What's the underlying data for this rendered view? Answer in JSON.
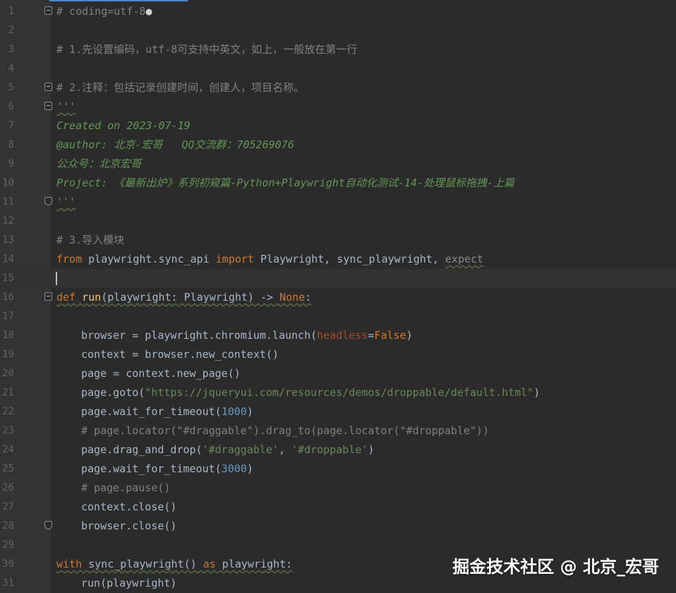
{
  "editor": {
    "lines": [
      "1",
      "2",
      "3",
      "4",
      "5",
      "6",
      "7",
      "8",
      "9",
      "10",
      "11",
      "12",
      "13",
      "14",
      "15",
      "16",
      "17",
      "18",
      "19",
      "20",
      "21",
      "22",
      "23",
      "24",
      "25",
      "26",
      "27",
      "28",
      "29",
      "30",
      "31"
    ],
    "code": {
      "l1": "# coding=utf-8",
      "l3": "# 1.先设置编码，utf-8可支持中英文，如上，一般放在第一行",
      "l5": "# 2.注释：包括记录创建时间，创建人，项目名称。",
      "l6": "'''",
      "l7": "Created on 2023-07-19",
      "l8": "@author: 北京-宏哥   QQ交流群：705269076",
      "l9": "公众号：北京宏哥",
      "l10": "Project: 《最新出炉》系列初窥篇-Python+Playwright自动化测试-14-处理鼠标拖拽-上篇",
      "l11": "'''",
      "l13": "# 3.导入模块",
      "l14": {
        "from": "from",
        "module": " playwright.sync_api ",
        "import": "import",
        "names": " Playwright, sync_playwright, ",
        "expect": "expect"
      },
      "l16": {
        "def": "def",
        "name": "run",
        "sig_a": "(playwright: Playwright) -> ",
        "none": "None",
        "colon": ":"
      },
      "l18": {
        "a": "browser = playwright.chromium.launch(",
        "param": "headless",
        "eq": "=",
        "val": "False",
        "b": ")"
      },
      "l19": "context = browser.new_context()",
      "l20": "page = context.new_page()",
      "l21": {
        "a": "page.goto(",
        "url": "\"https://jqueryui.com/resources/demos/droppable/default.html\"",
        "b": ")"
      },
      "l22": {
        "a": "page.wait_for_timeout(",
        "num": "1000",
        "b": ")"
      },
      "l23": "# page.locator(\"#draggable\").drag_to(page.locator(\"#droppable\"))",
      "l24": {
        "a": "page.drag_and_drop(",
        "s1": "'#draggable'",
        "sep": ", ",
        "s2": "'#droppable'",
        "b": ")"
      },
      "l25": {
        "a": "page.wait_for_timeout(",
        "num": "3000",
        "b": ")"
      },
      "l26": "# page.pause()",
      "l27": "context.close()",
      "l28": "browser.close()",
      "l30": {
        "with": "with",
        "a": " sync_playwright() ",
        "as": "as",
        "b": " playwright:"
      },
      "l31": "run(playwright)"
    }
  },
  "watermark": "掘金技术社区 @ 北京_宏哥",
  "colors": {
    "background": "#2b2b2b",
    "gutter": "#313335",
    "comment": "#808080",
    "docstring": "#629755",
    "keyword": "#cc7832",
    "function": "#ffc66d",
    "number": "#6897bb",
    "string": "#6a8759"
  }
}
